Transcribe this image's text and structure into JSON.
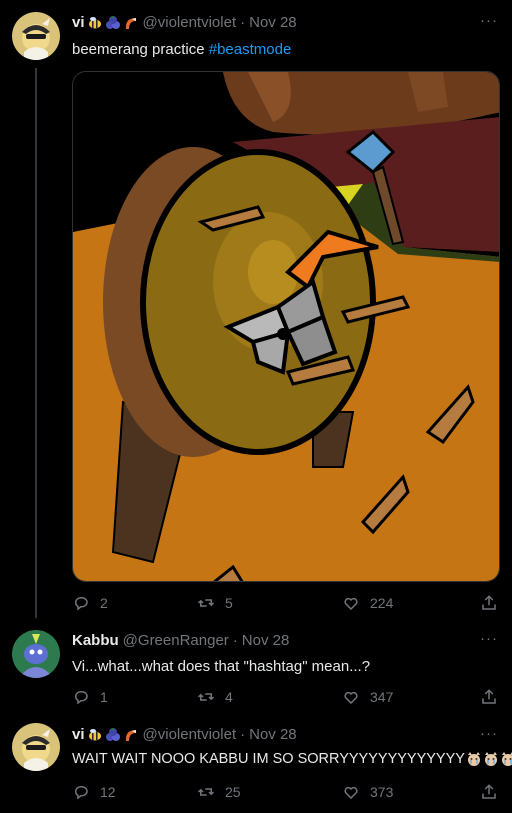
{
  "tweets": [
    {
      "name": "vi",
      "handle": "@violentviolet",
      "separator": "·",
      "date": "Nov 28",
      "text_before": "beemerang practice ",
      "hashtag": "#beastmode",
      "reply_count": "2",
      "retweet_count": "5",
      "like_count": "224"
    },
    {
      "name": "Kabbu",
      "handle": "@GreenRanger",
      "separator": "·",
      "date": "Nov 28",
      "text": "Vi...what...what does that \"hashtag\" mean...?",
      "reply_count": "1",
      "retweet_count": "4",
      "like_count": "347"
    },
    {
      "name": "vi",
      "handle": "@violentviolet",
      "separator": "·",
      "date": "Nov 28",
      "text": "WAIT WAIT NOOO KABBU IM SO SORRYYYYYYYYYYYYY",
      "reply_count": "12",
      "retweet_count": "25",
      "like_count": "373"
    }
  ],
  "more_label": "···",
  "icons": {
    "header_emojis": [
      "bee-emoji-icon",
      "blueberry-emoji-icon",
      "beemerang-emoji-icon"
    ],
    "trailing_emojis": [
      "crying-cat-icon",
      "crying-cat-icon",
      "crying-cat-icon"
    ]
  },
  "colors": {
    "background": "#000000",
    "text": "#e7e9ea",
    "secondary": "#71767b",
    "link": "#1d9bf0",
    "thread_line": "#333639"
  }
}
